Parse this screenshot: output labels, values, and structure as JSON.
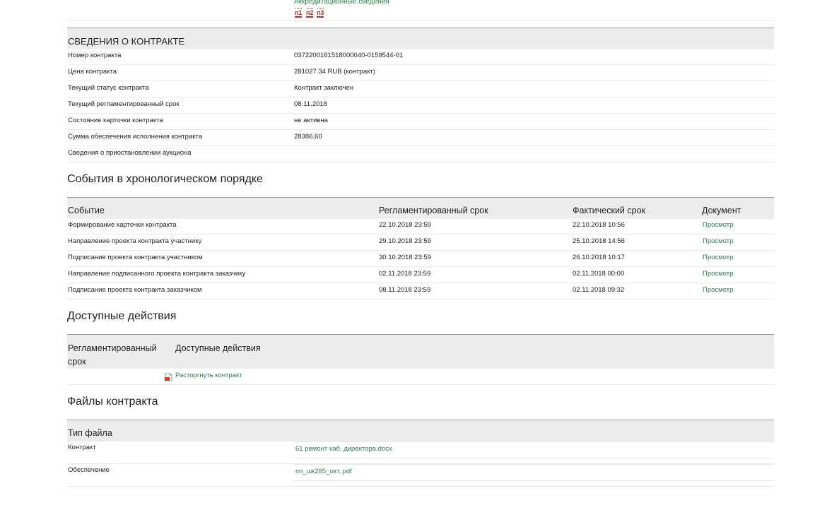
{
  "accreditation": {
    "label": "Аккредитационные сведения",
    "badges": [
      "п1",
      "п2",
      "п3"
    ]
  },
  "contract_info": {
    "title": "СВЕДЕНИЯ О КОНТРАКТЕ",
    "rows": [
      {
        "label": "Номер контракта",
        "value": "0372200161518000040-0159544-01"
      },
      {
        "label": "Цена контракта",
        "value": "281027.34  RUB  (контракт)"
      },
      {
        "label": "Текущий статус контракта",
        "value": "Контракт заключен"
      },
      {
        "label": "Текущий регламентированный срок",
        "value": "08.11.2018"
      },
      {
        "label": "Состояние карточки контракта",
        "value": "не активна"
      },
      {
        "label": "Сумма обеспечения исполнения контракта",
        "value": "28386.60"
      },
      {
        "label": "Сведения о приостановлении аукциона",
        "value": ""
      }
    ]
  },
  "events": {
    "title": "События в хронологическом порядке",
    "columns": [
      "Событие",
      "Регламентированный срок",
      "Фактический срок",
      "Документ"
    ],
    "rows": [
      {
        "event": "Формирование карточки контракта",
        "reg": "22.10.2018 23:59",
        "fact": "22.10.2018 10:56",
        "doc": "Просмотр"
      },
      {
        "event": "Направление проекта контракта участнику",
        "reg": "29.10.2018 23:59",
        "fact": "25.10.2018 14:56",
        "doc": "Просмотр"
      },
      {
        "event": "Подписание проекта контракта участником",
        "reg": "30.10.2018 23:59",
        "fact": "26.10.2018 10:17",
        "doc": "Просмотр"
      },
      {
        "event": "Направление подписанного проекта контракта заказчику",
        "reg": "02.11.2018 23:59",
        "fact": "02.11.2018 00:00",
        "doc": "Просмотр"
      },
      {
        "event": "Подписание проекта контракта заказчиком",
        "reg": "08.11.2018 23:59",
        "fact": "02.11.2018 09:32",
        "doc": "Просмотр"
      }
    ]
  },
  "actions": {
    "title": "Доступные действия",
    "col_reg_line1": "Регламентированный",
    "col_reg_line2": "срок",
    "col_actions": "Доступные действия",
    "terminate_label": "Расторгнуть контракт",
    "terminate_icon": "pdf-icon"
  },
  "files": {
    "title": "Файлы контракта",
    "column": "Тип файла",
    "rows": [
      {
        "type": "Контракт",
        "file": "61 ремонт каб. директора.docx"
      },
      {
        "type": "Обеспечение",
        "file": "пп_шк285_окт..pdf"
      }
    ]
  }
}
